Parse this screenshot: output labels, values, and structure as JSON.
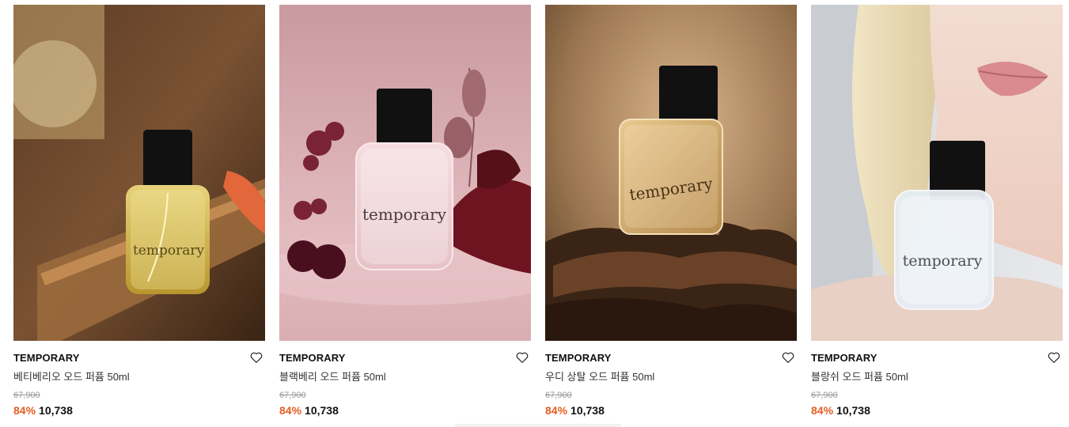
{
  "products": [
    {
      "brand": "TEMPORARY",
      "name": "베티베리오 오드 퍼퓸 50ml",
      "original_price": "67,900",
      "discount": "84%",
      "price": "10,738",
      "image_label": "temporary"
    },
    {
      "brand": "TEMPORARY",
      "name": "블랙베리 오드 퍼퓸 50ml",
      "original_price": "67,900",
      "discount": "84%",
      "price": "10,738",
      "image_label": "temporary"
    },
    {
      "brand": "TEMPORARY",
      "name": "우디 상탈 오드 퍼퓸 50ml",
      "original_price": "67,900",
      "discount": "84%",
      "price": "10,738",
      "image_label": "temporary"
    },
    {
      "brand": "TEMPORARY",
      "name": "블랑쉬 오드 퍼퓸 50ml",
      "original_price": "67,900",
      "discount": "84%",
      "price": "10,738",
      "image_label": "temporary"
    }
  ],
  "colors": {
    "discount": "#e35d24",
    "strike": "#999999"
  },
  "icons": {
    "like": "heart-outline-icon"
  }
}
